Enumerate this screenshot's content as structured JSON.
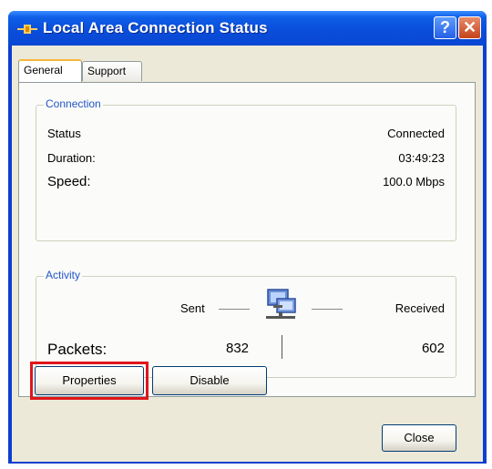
{
  "window": {
    "title": "Local Area Connection Status",
    "help_label": "?",
    "close_label": "✕"
  },
  "tabs": [
    {
      "label": "General",
      "active": true
    },
    {
      "label": "Support",
      "active": false
    }
  ],
  "connection": {
    "legend": "Connection",
    "rows": [
      {
        "label": "Status",
        "value": "Connected"
      },
      {
        "label": "Duration:",
        "value": "03:49:23"
      },
      {
        "label": "Speed:",
        "value": "100.0 Mbps"
      }
    ]
  },
  "activity": {
    "legend": "Activity",
    "sent_label": "Sent",
    "received_label": "Received",
    "packets_label": "Packets:",
    "packets_sent": "832",
    "packets_received": "602"
  },
  "buttons": {
    "properties": "Properties",
    "disable": "Disable",
    "close": "Close"
  },
  "colors": {
    "titlebar": "#0a4edb",
    "highlight": "#e0161b",
    "groupbox_label": "#2355c7"
  }
}
